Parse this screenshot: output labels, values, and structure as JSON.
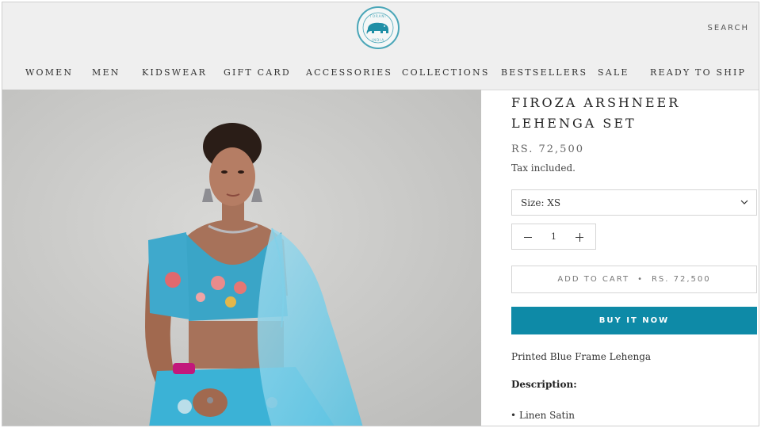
{
  "header": {
    "logo_text_top": "TORANI",
    "logo_text_bottom": "INDIA",
    "search_label": "SEARCH"
  },
  "nav": {
    "items": [
      "WOMEN",
      "MEN",
      "KIDSWEAR",
      "GIFT CARD",
      "ACCESSORIES",
      "COLLECTIONS",
      "BESTSELLERS",
      "SALE",
      "READY TO SHIP"
    ]
  },
  "product": {
    "title": "FIROZA ARSHNEER LEHENGA SET",
    "price": "RS. 72,500",
    "tax_note": "Tax included.",
    "size_label": "Size: XS",
    "quantity": "1",
    "add_to_cart_label": "ADD TO CART",
    "add_to_cart_price": "RS. 72,500",
    "buy_now_label": "BUY IT NOW",
    "short_description": "Printed Blue Frame Lehenga",
    "description_heading": "Description:",
    "description_items": [
      "Linen Satin"
    ]
  },
  "colors": {
    "accent": "#0e8aa7",
    "header_bg": "#efefef",
    "logo_teal": "#4aa6b8"
  },
  "icons": {
    "size_dropdown": "chevron-down-icon",
    "qty_decrease": "minus-icon",
    "qty_increase": "plus-icon"
  }
}
